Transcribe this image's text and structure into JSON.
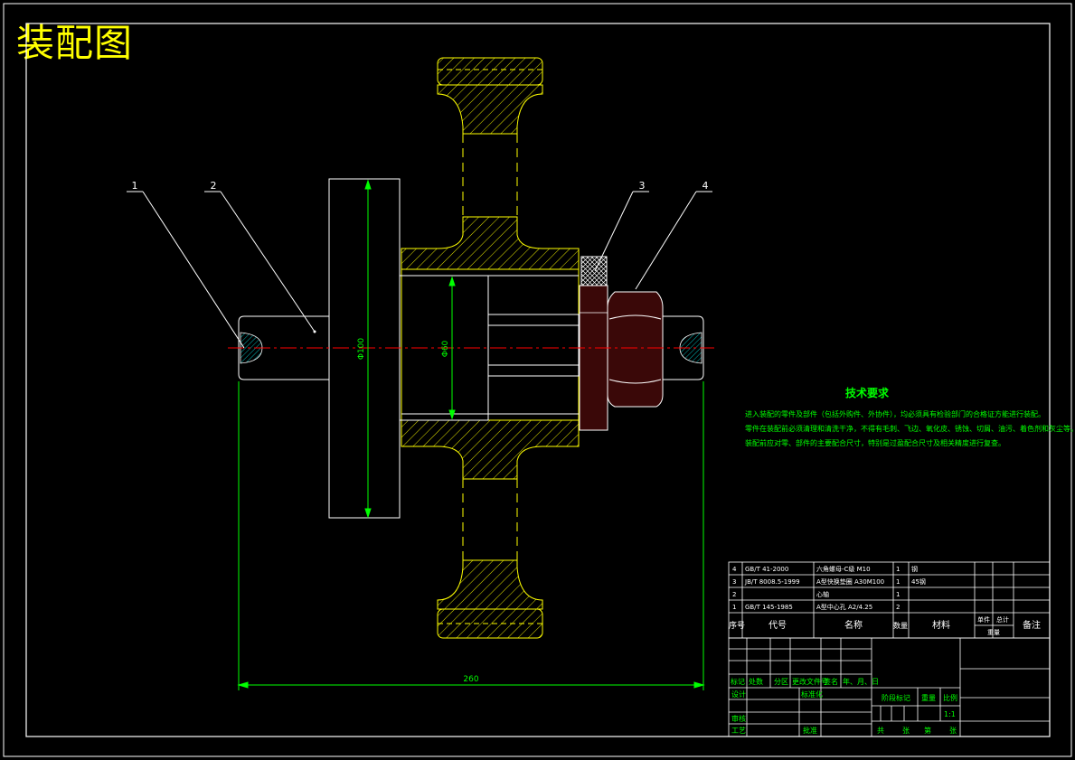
{
  "title": "装配图",
  "part_labels": [
    "1",
    "2",
    "3",
    "4"
  ],
  "dimensions": {
    "overall_length": "260",
    "flange_diameter": "Φ100",
    "bore_diameter": "Φ60"
  },
  "tech_requirements": {
    "title": "技术要求",
    "lines": [
      "进入装配的零件及部件（包括外购件、外协件），均必须具有检验部门的合格证方能进行装配。",
      "零件在装配前必须清理和清洗干净，不得有毛刺、飞边、氧化皮、锈蚀、切屑、油污、着色剂和灰尘等。",
      "装配前应对零、部件的主要配合尺寸，特别是过盈配合尺寸及相关精度进行复查。"
    ]
  },
  "bom": [
    {
      "no": "4",
      "code": "GB/T 41-2000",
      "name": "六角螺母-C级 M10",
      "qty": "1",
      "material": "钢"
    },
    {
      "no": "3",
      "code": "JB/T 8008.5-1999",
      "name": "A型快换垫圈 A30M100",
      "qty": "1",
      "material": "45钢"
    },
    {
      "no": "2",
      "code": "",
      "name": "心轴",
      "qty": "1",
      "material": ""
    },
    {
      "no": "1",
      "code": "GB/T 145-1985",
      "name": "A型中心孔 A2/4.25",
      "qty": "2",
      "material": ""
    }
  ],
  "bom_header": {
    "no": "序号",
    "code": "代号",
    "name": "名称",
    "qty": "数量",
    "material": "材料",
    "unit": "单件",
    "total": "总计",
    "weight": "重量",
    "remark": "备注"
  },
  "title_block": {
    "mark": "标记",
    "count": "处数",
    "zone": "分区",
    "change_doc": "更改文件号",
    "signature": "签名",
    "date": "年、月、日",
    "design": "设计",
    "standardize": "标准化",
    "check": "审核",
    "process": "工艺",
    "approve": "批准",
    "stage_mark": "阶段标记",
    "weight": "重量",
    "scale": "比例",
    "scale_value": "1:1",
    "sheets_total": "共",
    "sheets": "张",
    "sheet_no": "第",
    "sheet": "张"
  },
  "colors": {
    "frame": "#ffffff",
    "yellow": "#ffff00",
    "green": "#00ff00",
    "center": "#ff0000",
    "maroon": "#3a0808",
    "cyan": "#00ffff"
  }
}
